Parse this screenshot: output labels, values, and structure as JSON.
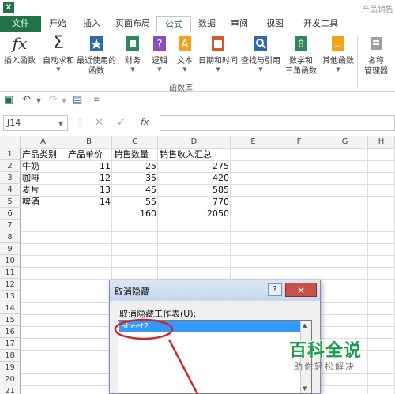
{
  "window": {
    "title": "产品销售"
  },
  "tabs": {
    "file": "文件",
    "home": "开始",
    "insert": "插入",
    "layout": "页面布局",
    "formula": "公式",
    "data": "数据",
    "review": "审阅",
    "view": "视图",
    "dev": "开发工具"
  },
  "ribbon": {
    "insert_function": "插入函数",
    "autosum": "自动求和",
    "recent": "最近使用的\n函数",
    "finance": "财务",
    "logic": "逻辑",
    "text": "文本",
    "datetime": "日期和时间",
    "lookup": "查找与引用",
    "math": "数学和\n三角函数",
    "other": "其他函数",
    "name_manager": "名称\n管理器",
    "group_label": "函数库"
  },
  "formula_bar": {
    "name_box": "J14",
    "fx": "fx",
    "formula": ""
  },
  "columns": [
    "A",
    "B",
    "C",
    "D",
    "E",
    "F",
    "G",
    "H"
  ],
  "rows": [
    "1",
    "2",
    "3",
    "4",
    "5",
    "6",
    "7",
    "8",
    "9",
    "10",
    "11",
    "12",
    "13",
    "14",
    "15",
    "16",
    "17",
    "18",
    "19",
    "20",
    "21"
  ],
  "table": {
    "headers": [
      "产品类别",
      "产品单价",
      "销售数量",
      "销售收入汇总"
    ],
    "rows": [
      [
        "牛奶",
        "11",
        "25",
        "275"
      ],
      [
        "咖啡",
        "12",
        "35",
        "420"
      ],
      [
        "麦片",
        "13",
        "45",
        "585"
      ],
      [
        "啤酒",
        "14",
        "55",
        "770"
      ]
    ],
    "totals": [
      "",
      "",
      "160",
      "2050"
    ]
  },
  "dialog": {
    "title": "取消隐藏",
    "help": "?",
    "close": "✕",
    "label": "取消隐藏工作表(U):",
    "items": [
      "Sheet2"
    ]
  },
  "watermark": {
    "logo": "百科全说",
    "sub": "助你轻松解决"
  },
  "colors": {
    "excel_green": "#217346",
    "selection": "#3399ff",
    "annotation": "#d0282e"
  }
}
